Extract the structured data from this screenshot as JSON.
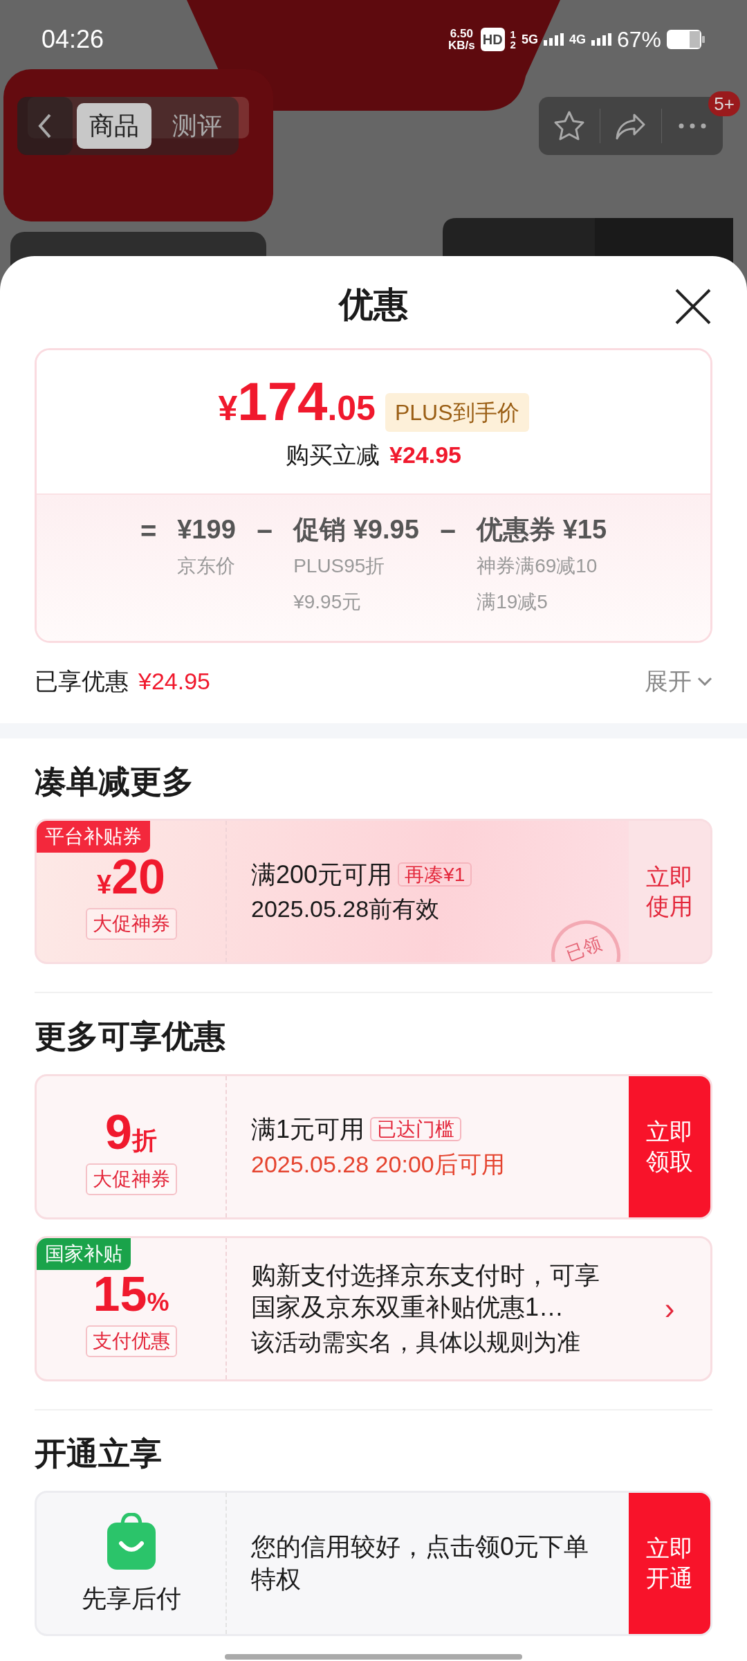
{
  "status_bar": {
    "time": "04:26",
    "speed": "6.50",
    "speed_unit": "KB/s",
    "hd": "HD",
    "sim_labels": [
      "1",
      "2"
    ],
    "networks": [
      "5G",
      "4G"
    ],
    "battery": "67%"
  },
  "header": {
    "tabs": [
      {
        "label": "商品",
        "selected": true
      },
      {
        "label": "测评",
        "selected": false
      }
    ],
    "badge": "5+"
  },
  "sheet": {
    "title": "优惠"
  },
  "price_card": {
    "currency": "¥",
    "integer": "174",
    "decimal": ".05",
    "tag": "PLUS到手价",
    "cut_label": "购买立减",
    "cut_amount": "¥24.95",
    "breakdown": [
      {
        "op": "=",
        "amount": "¥199",
        "notes": [
          "京东价"
        ]
      },
      {
        "op": "−",
        "label": "促销",
        "amount": "¥9.95",
        "notes": [
          "PLUS95折",
          "¥9.95元"
        ]
      },
      {
        "op": "−",
        "label": "优惠券",
        "amount": "¥15",
        "notes": [
          "神券满69减10",
          "满19减5"
        ]
      }
    ]
  },
  "summary": {
    "label": "已享优惠",
    "amount": "¥24.95",
    "expand": "展开"
  },
  "sections": [
    {
      "title": "凑单减更多",
      "coupons": [
        {
          "kind": "amount",
          "ribbon": {
            "text": "平台补贴券",
            "color": "#f3283c"
          },
          "currency": "¥",
          "value": "20",
          "tag": "大促神券",
          "title": "满200元可用",
          "title_tag": "再凑¥1",
          "line": "2025.05.28前有效",
          "urgent": false,
          "stamp": "已领",
          "action": {
            "kind": "soft",
            "label": "立即使用"
          }
        }
      ]
    },
    {
      "title": "更多可享优惠",
      "coupons": [
        {
          "kind": "discount",
          "value": "9",
          "unit": "折",
          "tag": "大促神券",
          "title": "满1元可用",
          "title_tag": "已达门槛",
          "line": "2025.05.28 20:00后可用",
          "urgent": true,
          "action": {
            "kind": "solid",
            "label": "立即领取"
          }
        },
        {
          "kind": "discount",
          "ribbon": {
            "text": "国家补贴",
            "color": "#1aa34a"
          },
          "value": "15",
          "unit": "%",
          "tag": "支付优惠",
          "title": "购新支付选择京东支付时，可享国家及京东双重补贴优惠1…",
          "line": "该活动需实名，具体以规则为准",
          "urgent": false,
          "action": {
            "kind": "arrow",
            "label": "›"
          }
        }
      ]
    },
    {
      "title": "开通立享",
      "coupons": [
        {
          "kind": "icon",
          "caption": "先享后付",
          "title": "您的信用较好，点击领0元下单特权",
          "action": {
            "kind": "solid",
            "label": "立即开通"
          }
        }
      ]
    }
  ]
}
